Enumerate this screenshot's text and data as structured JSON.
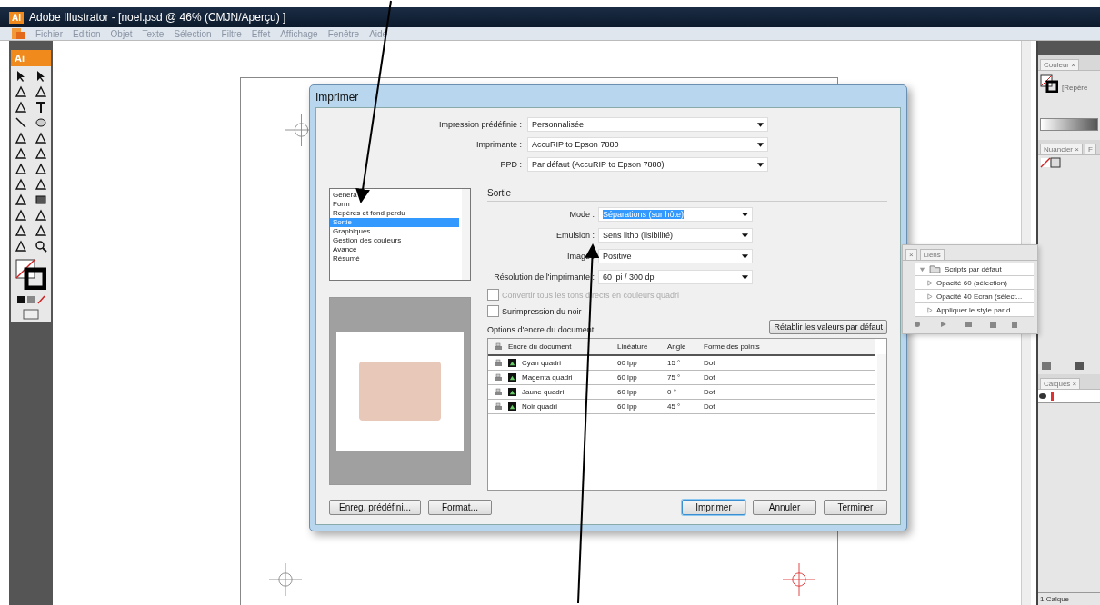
{
  "window": {
    "title": "Adobe Illustrator - [noel.psd @ 46% (CMJN/Aperçu) ]",
    "title_badge": "Ai",
    "toolbar_badge": "Ai"
  },
  "menu": [
    "Fichier",
    "Edition",
    "Objet",
    "Texte",
    "Sélection",
    "Filtre",
    "Effet",
    "Affichage",
    "Fenêtre",
    "Aide"
  ],
  "print_dialog": {
    "title": "Imprimer",
    "presets": [
      {
        "label": "Impression prédéfinie :",
        "value": "Personnalisée"
      },
      {
        "label": "Imprimante :",
        "value": "AccuRIP to Epson 7880"
      },
      {
        "label": "PPD :",
        "value": "Par défaut (AccuRIP to Epson 7880)"
      }
    ],
    "categories": [
      {
        "label": "Généra",
        "selected": false
      },
      {
        "label": "Form",
        "selected": false
      },
      {
        "label": "Repères et fond perdu",
        "selected": false
      },
      {
        "label": "Sortie",
        "selected": true
      },
      {
        "label": "Graphiques",
        "selected": false
      },
      {
        "label": "Gestion des couleurs",
        "selected": false
      },
      {
        "label": "Avancé",
        "selected": false
      },
      {
        "label": "Résumé",
        "selected": false
      }
    ],
    "section_title": "Sortie",
    "output_fields": [
      {
        "label": "Mode :",
        "value": "Séparations (sur hôte)",
        "selected": true
      },
      {
        "label": "Emulsion :",
        "value": "Sens litho (lisibilité)",
        "selected": false
      },
      {
        "label": "Image :",
        "value": "Positive",
        "selected": false
      },
      {
        "label": "Résolution de l'imprimante :",
        "value": "60 lpi / 300 dpi",
        "selected": false
      }
    ],
    "checkboxes": [
      {
        "label": "Convertir tous les tons directs en couleurs quadri",
        "checked": false,
        "disabled": true
      },
      {
        "label": "Surimpression du noir",
        "checked": false,
        "disabled": false
      }
    ],
    "ink_options_title": "Options d'encre du document",
    "reset_button": "Rétablir les valeurs par défaut",
    "ink_columns": [
      "Encre du document",
      "Linéature",
      "Angle",
      "Forme des points"
    ],
    "inks": [
      {
        "name": "Cyan quadri",
        "lineature": "60 lpp",
        "angle": "15 °",
        "shape": "Dot"
      },
      {
        "name": "Magenta quadri",
        "lineature": "60 lpp",
        "angle": "75 °",
        "shape": "Dot"
      },
      {
        "name": "Jaune quadri",
        "lineature": "60 lpp",
        "angle": "0 °",
        "shape": "Dot"
      },
      {
        "name": "Noir quadri",
        "lineature": "60 lpp",
        "angle": "45 °",
        "shape": "Dot"
      }
    ],
    "left_buttons": [
      {
        "label": "Enreg. prédéfini...",
        "default": false
      },
      {
        "label": "Format...",
        "default": false
      }
    ],
    "right_buttons": [
      {
        "label": "Imprimer",
        "default": true
      },
      {
        "label": "Annuler",
        "default": false
      },
      {
        "label": "Terminer",
        "default": false
      }
    ]
  },
  "color_panel": {
    "tab": "Couleur ×",
    "swatch_label": "[Repère"
  },
  "swatches_panel": {
    "tabs": [
      "Nuancier ×",
      "F"
    ]
  },
  "actions_panel": {
    "tabs": [
      "×",
      "Liens"
    ],
    "items": [
      {
        "label": "Scripts par défaut",
        "kind": "folder",
        "expanded": true
      },
      {
        "label": "Opacité 60 (sélection)",
        "kind": "action",
        "expanded": false
      },
      {
        "label": "Opacité 40 Ecran (sélect...",
        "kind": "action",
        "expanded": false
      },
      {
        "label": "Appliquer le style par d...",
        "kind": "action",
        "expanded": false
      }
    ]
  },
  "layers_panel": {
    "tab": "Calques ×",
    "status": "1 Calque"
  }
}
